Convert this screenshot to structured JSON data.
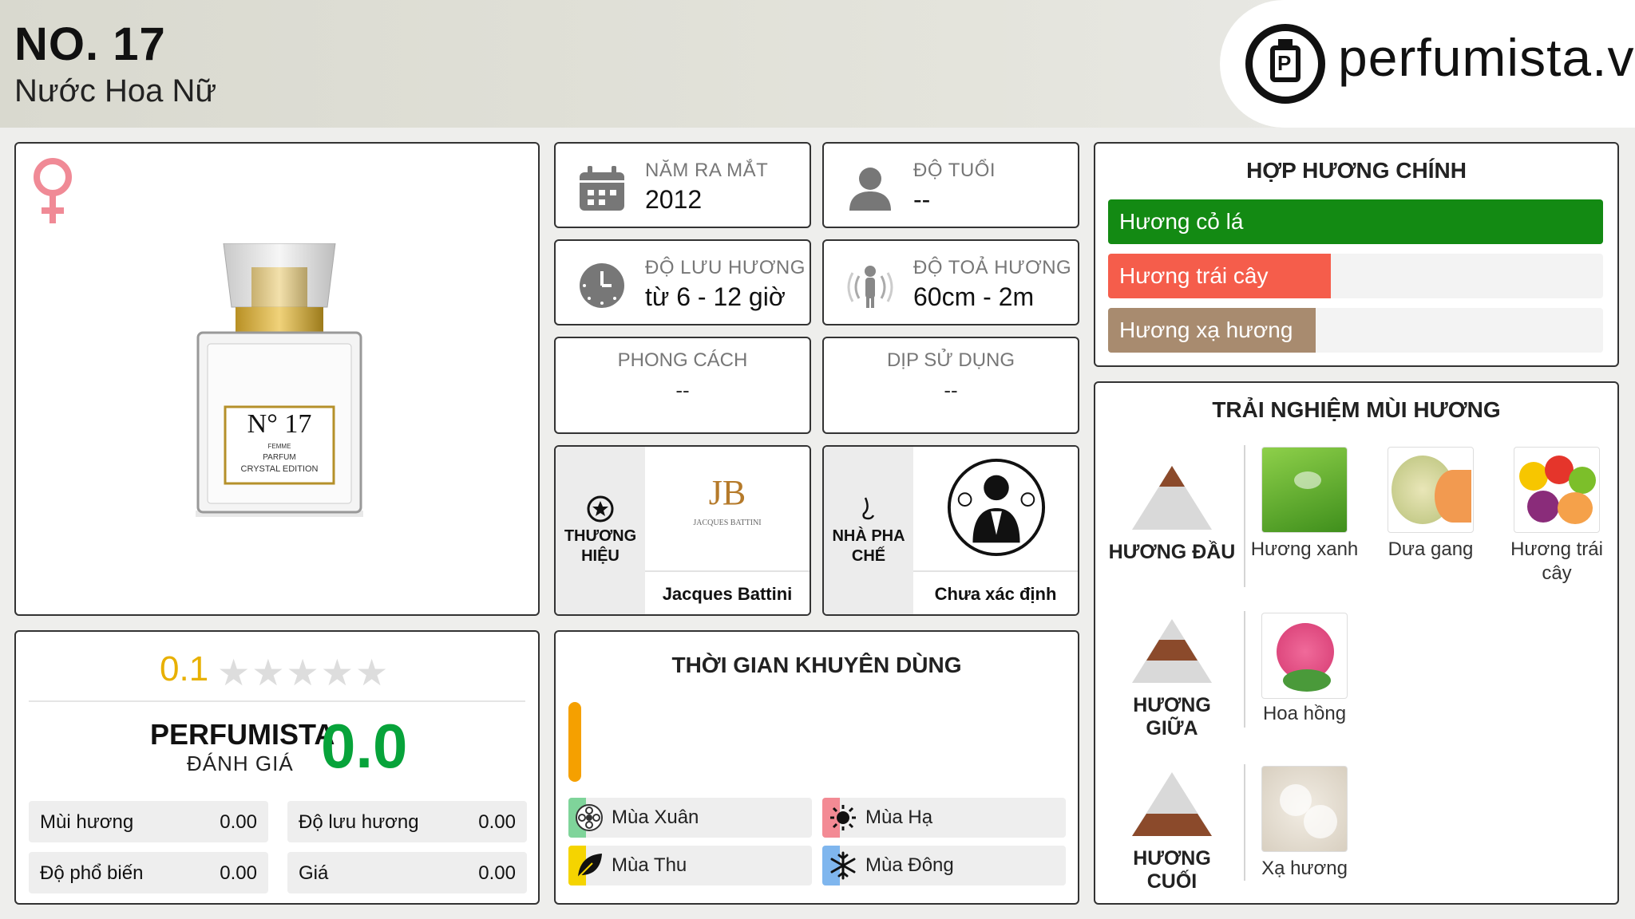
{
  "header": {
    "title": "NO. 17",
    "subtitle": "Nước Hoa Nữ",
    "brand_site": "perfumista.vn"
  },
  "product": {
    "bottle_label_line1": "N° 17",
    "bottle_label_line2": "FEMME",
    "bottle_label_line3": "PARFUM",
    "bottle_label_line4": "CRYSTAL EDITION"
  },
  "info": {
    "launch_year": {
      "label": "NĂM RA MẮT",
      "value": "2012"
    },
    "age": {
      "label": "ĐỘ TUỔI",
      "value": "--"
    },
    "longevity": {
      "label": "ĐỘ LƯU HƯƠNG",
      "value": "từ 6 - 12 giờ"
    },
    "sillage": {
      "label": "ĐỘ TOẢ HƯƠNG",
      "value": "60cm - 2m"
    },
    "style": {
      "label": "PHONG CÁCH",
      "value": "--"
    },
    "occasion": {
      "label": "DỊP SỬ DỤNG",
      "value": "--"
    }
  },
  "brand": {
    "label": "THƯƠNG HIỆU",
    "name": "Jacques Battini",
    "logo_text": "JB",
    "logo_sub": "JACQUES BATTINI"
  },
  "perfumer": {
    "label": "NHÀ PHA CHẾ",
    "name": "Chưa xác định"
  },
  "accords": {
    "title": "HỢP HƯƠNG CHÍNH",
    "items": [
      {
        "label": "Hương cỏ lá",
        "level": 1.0,
        "color": "#138a13"
      },
      {
        "label": "Hương trái cây",
        "level": 0.45,
        "color": "#f55d4b"
      },
      {
        "label": "Hương xạ hương",
        "level": 0.42,
        "color": "#a88b6f"
      }
    ]
  },
  "experience": {
    "title": "TRẢI NGHIỆM MÙI HƯƠNG",
    "top": {
      "label": "HƯƠNG ĐẦU",
      "notes": [
        "Hương xanh",
        "Dưa gang",
        "Hương trái cây"
      ]
    },
    "middle": {
      "label": "HƯƠNG GIỮA",
      "notes": [
        "Hoa hồng"
      ]
    },
    "base": {
      "label": "HƯƠNG CUỐI",
      "notes": [
        "Xạ hương"
      ]
    }
  },
  "rating": {
    "user_score": "0.1",
    "stars_filled": 0,
    "stars_total": 5,
    "perfumista_label": "PERFUMISTA",
    "perfumista_sub": "ĐÁNH GIÁ",
    "perfumista_score": "0.0",
    "metrics": [
      {
        "label": "Mùi hương",
        "value": "0.00"
      },
      {
        "label": "Độ lưu hương",
        "value": "0.00"
      },
      {
        "label": "Độ phổ biến",
        "value": "0.00"
      },
      {
        "label": "Giá",
        "value": "0.00"
      }
    ]
  },
  "usage": {
    "title": "THỜI GIAN KHUYÊN DÙNG",
    "seasons": [
      {
        "label": "Mùa Xuân",
        "color": "#7fd49a"
      },
      {
        "label": "Mùa Hạ",
        "color": "#f38a94"
      },
      {
        "label": "Mùa Thu",
        "color": "#f5d400"
      },
      {
        "label": "Mùa Đông",
        "color": "#7fb6ee"
      }
    ]
  }
}
